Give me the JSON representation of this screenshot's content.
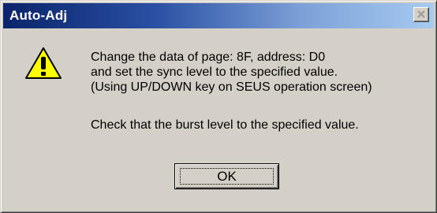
{
  "window": {
    "title": "Auto-Adj"
  },
  "dialog": {
    "icon": "warning-icon",
    "lines": [
      "Change the data of page: 8F, address: D0",
      "and set the sync level to the specified value.",
      "(Using UP/DOWN key on SEUS operation screen)",
      "Check that the burst level to the specified value."
    ],
    "ok_label": "OK"
  },
  "colors": {
    "titlebar_start": "#0a246a",
    "titlebar_end": "#a6caf0",
    "dialog_bg": "#d4d0c8",
    "warning_yellow": "#ffff00"
  }
}
